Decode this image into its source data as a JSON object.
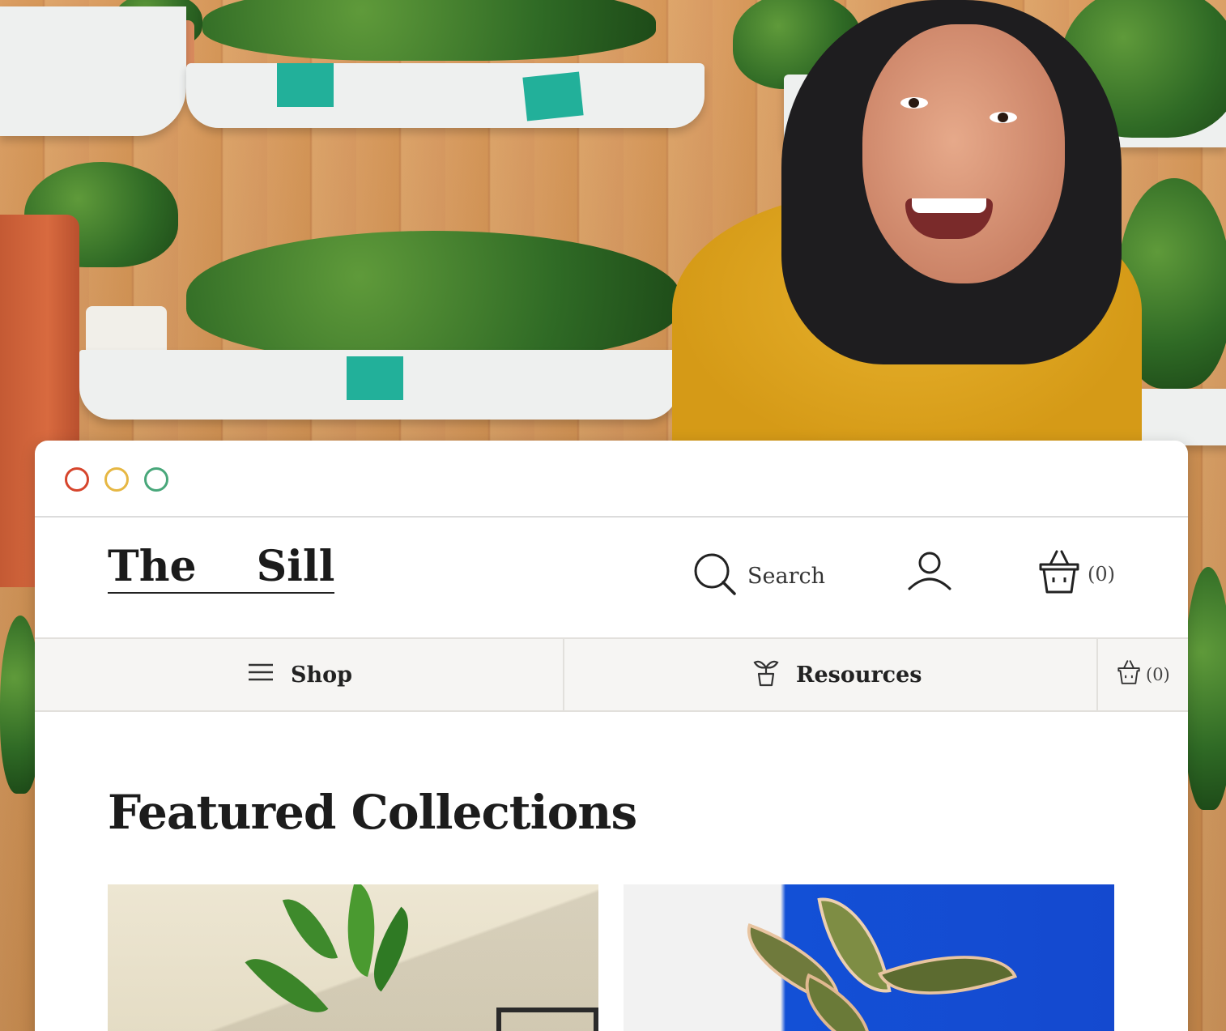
{
  "colors": {
    "dot_red": "#d6452c",
    "dot_yellow": "#e6b743",
    "dot_green": "#48a77a",
    "accent_teal": "#22b09a",
    "card2_blue": "#1449cf"
  },
  "window": {
    "controls": [
      "close-dot",
      "minimize-dot",
      "maximize-dot"
    ]
  },
  "header": {
    "logo_word_1": "The",
    "logo_word_2": "Sill",
    "search_label": "Search",
    "search_icon": "search-icon",
    "account_icon": "user-icon",
    "cart_icon": "basket-icon",
    "cart_count": "(0)"
  },
  "nav": {
    "shop_label": "Shop",
    "shop_icon": "hamburger-menu-icon",
    "resources_label": "Resources",
    "resources_icon": "sprout-icon",
    "cart_icon": "basket-icon",
    "cart_count": "(0)"
  },
  "main": {
    "section_title": "Featured Collections",
    "cards": [
      {
        "name": "collection-card-zz-plant"
      },
      {
        "name": "collection-card-rubber-plant"
      }
    ]
  }
}
